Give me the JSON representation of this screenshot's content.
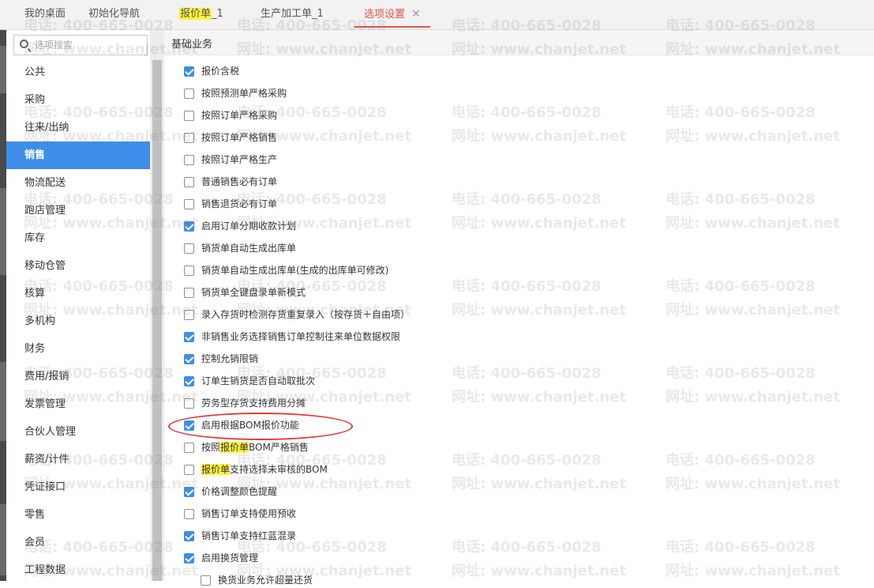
{
  "tabs": [
    {
      "label": "我的桌面"
    },
    {
      "label": "初始化导航"
    },
    {
      "label": "报价单",
      "suffix": "_1"
    },
    {
      "label": "生产加工单_1"
    },
    {
      "label": "选项设置",
      "close": "✕"
    }
  ],
  "search": {
    "placeholder": "选项搜索",
    "value": ""
  },
  "sidebar": {
    "items": [
      {
        "label": "公共"
      },
      {
        "label": "采购"
      },
      {
        "label": "往来/出纳"
      },
      {
        "label": "销售",
        "active": true
      },
      {
        "label": "物流配送"
      },
      {
        "label": "跑店管理"
      },
      {
        "label": "库存"
      },
      {
        "label": "移动仓管"
      },
      {
        "label": "核算"
      },
      {
        "label": "多机构"
      },
      {
        "label": "财务"
      },
      {
        "label": "费用/报销"
      },
      {
        "label": "发票管理"
      },
      {
        "label": "合伙人管理"
      },
      {
        "label": "薪资/计件"
      },
      {
        "label": "凭证接口"
      },
      {
        "label": "零售"
      },
      {
        "label": "会员"
      },
      {
        "label": "工程数据"
      }
    ]
  },
  "section": {
    "title": "基础业务"
  },
  "options": [
    {
      "label": "报价含税",
      "checked": true
    },
    {
      "label": "按照预测单严格采购",
      "checked": false
    },
    {
      "label": "按照订单严格采购",
      "checked": false
    },
    {
      "label": "按照订单严格销售",
      "checked": false
    },
    {
      "label": "按照订单严格生产",
      "checked": false
    },
    {
      "label": "普通销售必有订单",
      "checked": false
    },
    {
      "label": "销售退货必有订单",
      "checked": false
    },
    {
      "label": "启用订单分期收款计划",
      "checked": true
    },
    {
      "label": "销货单自动生成出库单",
      "checked": false
    },
    {
      "label": "销货单自动生成出库单(生成的出库单可修改)",
      "checked": false
    },
    {
      "label": "销货单全键盘录单新模式",
      "checked": false
    },
    {
      "label": "录入存货时检测存货重复录入（按存货＋自由项）",
      "checked": false
    },
    {
      "label": "非销售业务选择销售订单控制往来单位数据权限",
      "checked": true
    },
    {
      "label": "控制允销限销",
      "checked": true
    },
    {
      "label": "订单生销货是否自动取批次",
      "checked": true
    },
    {
      "label": "劳务型存货支持费用分摊",
      "checked": false
    },
    {
      "label": "启用根据BOM报价功能",
      "checked": true
    },
    {
      "pre": "按照",
      "hl": "报价单",
      "post": "BOM严格销售",
      "checked": false
    },
    {
      "pre": "",
      "hl": "报价单",
      "post": "支持选择未审核的BOM",
      "checked": false
    },
    {
      "label": "价格调整颜色提醒",
      "checked": true
    },
    {
      "label": "销售订单支持使用预收",
      "checked": false
    },
    {
      "label": "销售订单支持红蓝混录",
      "checked": true
    },
    {
      "label": "启用换货管理",
      "checked": true
    },
    {
      "label": "换货业务允许超量还货",
      "checked": false
    }
  ],
  "watermark": {
    "phone": "电话: 400-665-0028",
    "site": "网址: www.chanjet.net"
  },
  "colors": {
    "accent": "#3d8ee8",
    "active_tab": "#e94e4e",
    "highlight": "#fff23a",
    "annotation": "#e23b3b"
  }
}
